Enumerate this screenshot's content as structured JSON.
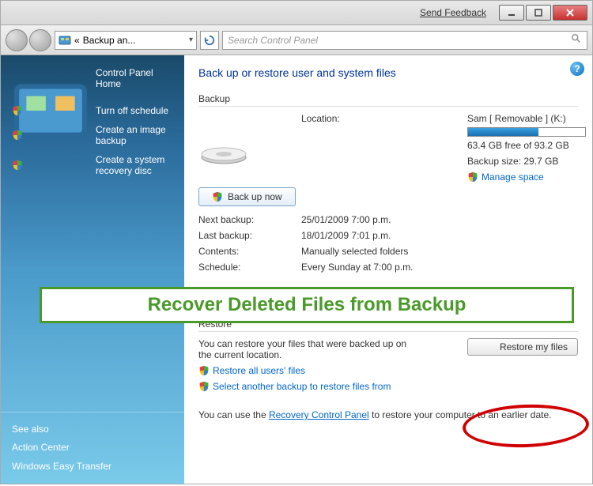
{
  "titlebar": {
    "feedback": "Send Feedback"
  },
  "toolbar": {
    "breadcrumb_prefix": "«",
    "breadcrumb": "Backup an...",
    "search_placeholder": "Search Control Panel"
  },
  "sidebar": {
    "home": "Control Panel Home",
    "items": [
      {
        "label": "Turn off schedule"
      },
      {
        "label": "Create an image backup"
      },
      {
        "label": "Create a system recovery disc"
      }
    ],
    "see_also_title": "See also",
    "see_also": [
      {
        "label": "Action Center"
      },
      {
        "label": "Windows Easy Transfer"
      }
    ]
  },
  "content": {
    "title": "Back up or restore user and system files",
    "backup": {
      "heading": "Backup",
      "location_label": "Location:",
      "location_value": "Sam [ Removable ] (K:)",
      "free_space": "63.4 GB free of 93.2 GB",
      "backup_size": "Backup size: 29.7 GB",
      "manage_space": "Manage space",
      "backup_now": "Back up now",
      "details": {
        "next_backup_label": "Next backup:",
        "next_backup_value": "25/01/2009 7:00 p.m.",
        "last_backup_label": "Last backup:",
        "last_backup_value": "18/01/2009 7:01 p.m.",
        "contents_label": "Contents:",
        "contents_value": "Manually selected folders",
        "schedule_label": "Schedule:",
        "schedule_value": "Every Sunday at 7:00 p.m."
      }
    },
    "overlay": "Recover Deleted Files from Backup",
    "restore": {
      "heading": "Restore",
      "text": "You can restore your files that were backed up on the current location.",
      "restore_btn": "Restore my files",
      "restore_all": "Restore all users' files",
      "select_another": "Select another backup to restore files from"
    },
    "bottom": {
      "prefix": "You can use the ",
      "link": "Recovery Control Panel",
      "suffix": " to restore your computer to an earlier date."
    }
  }
}
